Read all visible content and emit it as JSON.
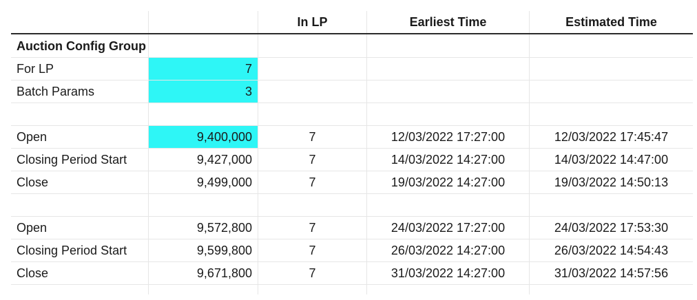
{
  "header": {
    "col_label": "",
    "col_value": "",
    "col_in_lp": "In LP",
    "col_earliest": "Earliest Time",
    "col_estimated": "Estimated Time"
  },
  "section_title": "Auction Config Group",
  "config_rows": [
    {
      "label": "For LP",
      "value": "7",
      "highlight": true
    },
    {
      "label": "Batch Params",
      "value": "3",
      "highlight": true
    }
  ],
  "batch1": [
    {
      "label": "Open",
      "value": "9,400,000",
      "in_lp": "7",
      "earliest": "12/03/2022 17:27:00",
      "estimated": "12/03/2022 17:45:47",
      "highlight": true
    },
    {
      "label": "Closing Period Start",
      "value": "9,427,000",
      "in_lp": "7",
      "earliest": "14/03/2022 14:27:00",
      "estimated": "14/03/2022 14:47:00",
      "highlight": false
    },
    {
      "label": "Close",
      "value": "9,499,000",
      "in_lp": "7",
      "earliest": "19/03/2022 14:27:00",
      "estimated": "19/03/2022 14:50:13",
      "highlight": false
    }
  ],
  "batch2": [
    {
      "label": "Open",
      "value": "9,572,800",
      "in_lp": "7",
      "earliest": "24/03/2022 17:27:00",
      "estimated": "24/03/2022 17:53:30",
      "highlight": false
    },
    {
      "label": "Closing Period Start",
      "value": "9,599,800",
      "in_lp": "7",
      "earliest": "26/03/2022 14:27:00",
      "estimated": "26/03/2022 14:54:43",
      "highlight": false
    },
    {
      "label": "Close",
      "value": "9,671,800",
      "in_lp": "7",
      "earliest": "31/03/2022 14:27:00",
      "estimated": "31/03/2022 14:57:56",
      "highlight": false
    }
  ],
  "colors": {
    "highlight": "#2ef6f6",
    "grid": "#e6e6e6",
    "header_rule": "#2a2a2a"
  }
}
